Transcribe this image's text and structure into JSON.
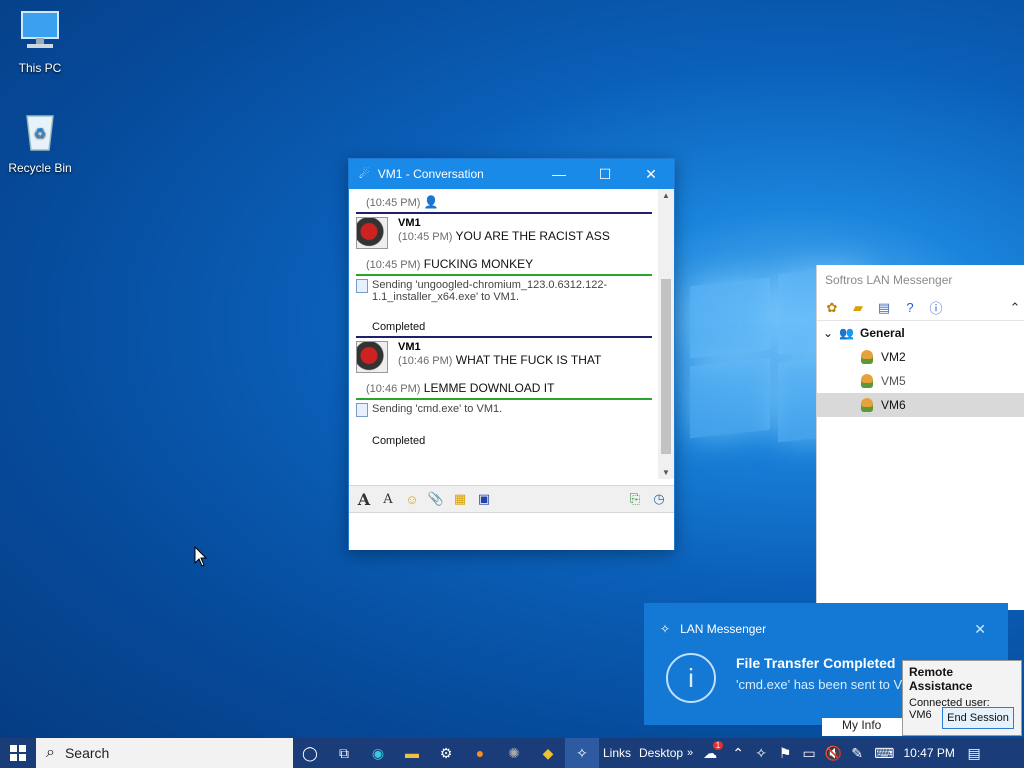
{
  "desktop": {
    "icons": [
      {
        "label": "This PC"
      },
      {
        "label": "Recycle Bin"
      }
    ]
  },
  "conversation": {
    "title": "VM1 - Conversation",
    "messages": [
      {
        "time": "(10:45 PM)",
        "text": ""
      },
      {
        "sender": "VM1",
        "time": "(10:45 PM)",
        "text": "YOU ARE THE RACIST ASS"
      },
      {
        "time": "(10:45 PM)",
        "text": "FUCKING MONKEY"
      },
      {
        "file": "Sending 'ungoogled-chromium_123.0.6312.122-1.1_installer_x64.exe' to VM1.",
        "status": "Completed"
      },
      {
        "sender": "VM1",
        "time": "(10:46 PM)",
        "text": "WHAT THE FUCK IS THAT"
      },
      {
        "time": "(10:46 PM)",
        "text": "LEMME DOWNLOAD IT"
      },
      {
        "file": "Sending 'cmd.exe' to VM1.",
        "status": "Completed"
      }
    ]
  },
  "lan_messenger": {
    "title": "Softros LAN Messenger",
    "group": "General",
    "users": [
      {
        "name": "VM2"
      },
      {
        "name": "VM5"
      },
      {
        "name": "VM6"
      }
    ]
  },
  "toast": {
    "app": "LAN Messenger",
    "title": "File Transfer Completed",
    "message": "'cmd.exe' has been sent to VM1"
  },
  "remote_assistance": {
    "title": "Remote Assistance",
    "connected": "Connected user: VM6",
    "button": "End Session",
    "behind_text": "My Info"
  },
  "taskbar": {
    "search_placeholder": "Search",
    "links": "Links",
    "desktop": "Desktop",
    "time": "10:47 PM",
    "badge": "1"
  },
  "colors": {
    "accent": "#1a8ae8",
    "taskbar": "#1a3c78",
    "toast": "#1479d4"
  }
}
